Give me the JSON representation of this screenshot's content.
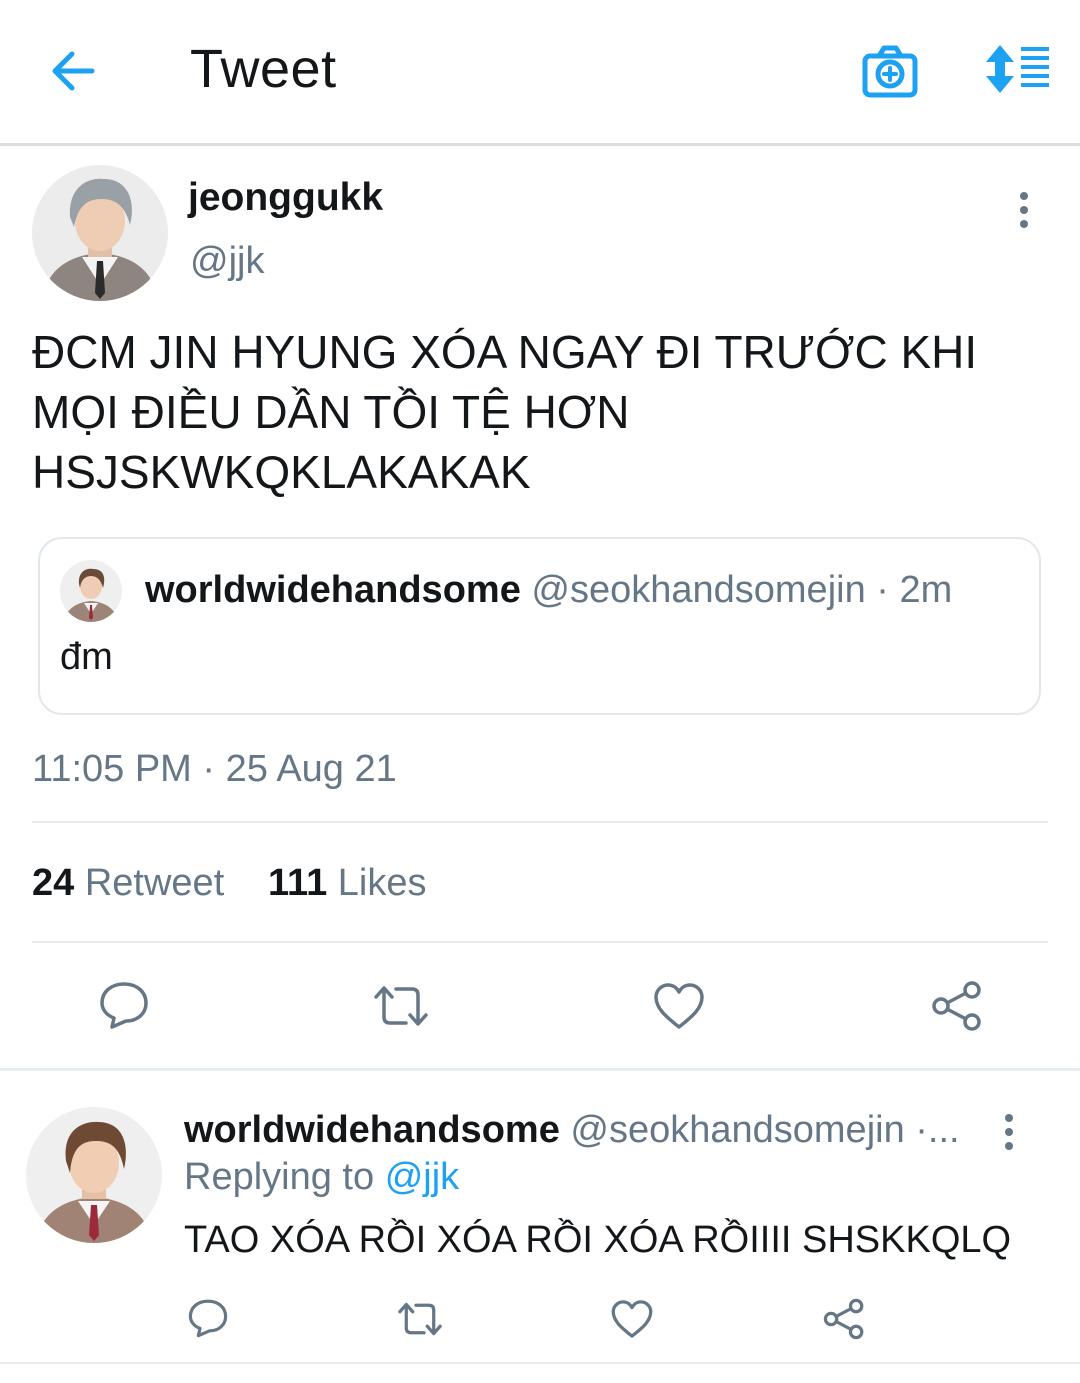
{
  "header": {
    "title": "Tweet",
    "back_icon": "arrow-left-icon",
    "camera_icon": "camera-add-icon",
    "sort_icon": "sort-list-icon",
    "accent": "#1da1f2"
  },
  "tweet": {
    "display_name": "jeonggukk",
    "handle": "@jjk",
    "text_lines": [
      "ĐCM JIN HYUNG XÓA NGAY ĐI TRƯỚC KHI",
      "MỌI ĐIỀU DẦN TỒI TỆ HƠN",
      "HSJSKWKQKLAKAKAK"
    ],
    "quote": {
      "display_name": "worldwidehandsome",
      "meta": "@seokhandsomejin · 2m",
      "text": "đm"
    },
    "timestamp": "11:05 PM · 25 Aug 21",
    "retweet_count": "24",
    "retweet_label": "Retweet",
    "like_count": "111",
    "like_label": "Likes"
  },
  "reply": {
    "display_name": "worldwidehandsome",
    "handle_meta": "@seokhandsomejin ·...",
    "replying_prefix": "Replying to",
    "replying_to": "@jjk",
    "text": "TAO XÓA RỒI XÓA RỒI XÓA RỒIIII SHSKKQLQ"
  },
  "colors": {
    "text_primary": "#14171a",
    "text_secondary": "#657786",
    "link": "#1da1f2",
    "divider": "#e6ecf0"
  }
}
